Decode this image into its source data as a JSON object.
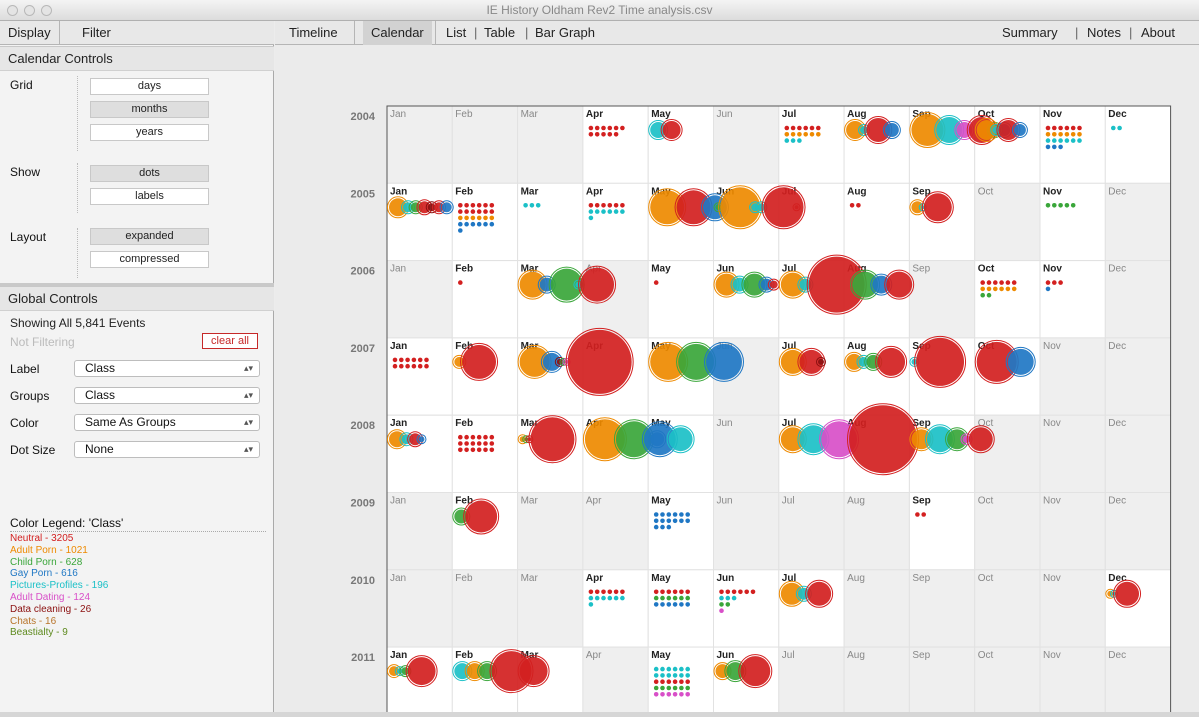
{
  "window": {
    "title": "IE History Oldham Rev2 Time analysis.csv"
  },
  "sidebar": {
    "tabs": [
      "Display",
      "Filter"
    ],
    "calendar_controls": {
      "title": "Calendar Controls",
      "grid_label": "Grid",
      "grid_options": [
        "days",
        "months",
        "years"
      ],
      "grid_selected": "months",
      "show_label": "Show",
      "show_options": [
        "dots",
        "labels"
      ],
      "show_selected": "dots",
      "layout_label": "Layout",
      "layout_options": [
        "expanded",
        "compressed"
      ],
      "layout_selected": "expanded"
    },
    "global_controls": {
      "title": "Global Controls",
      "showing": "Showing All 5,841 Events",
      "filter_status": "Not Filtering",
      "clear_all": "clear all",
      "label_label": "Label",
      "label_value": "Class",
      "groups_label": "Groups",
      "groups_value": "Class",
      "color_label": "Color",
      "color_value": "Same As Groups",
      "dotsize_label": "Dot Size",
      "dotsize_value": "None"
    },
    "legend": {
      "title": "Color Legend: 'Class'",
      "items": [
        {
          "text": "Neutral - 3205",
          "color": "#d32020"
        },
        {
          "text": "Adult Porn - 1021",
          "color": "#ee8a00"
        },
        {
          "text": "Child Porn - 628",
          "color": "#3aa63a"
        },
        {
          "text": "Gay Porn - 616",
          "color": "#1f77c4"
        },
        {
          "text": "Pictures-Profiles - 196",
          "color": "#1bc0c7"
        },
        {
          "text": "Adult Dating - 124",
          "color": "#d84fc8"
        },
        {
          "text": "Data cleaning - 26",
          "color": "#8b1010"
        },
        {
          "text": "Chats - 16",
          "color": "#b8742a"
        },
        {
          "text": "Beastialty - 9",
          "color": "#5e8a1e"
        }
      ]
    }
  },
  "main": {
    "tabs_left": [
      "Timeline",
      "Calendar",
      "List",
      "Table",
      "Bar Graph"
    ],
    "active_tab": "Calendar",
    "tabs_right": [
      "Summary",
      "Notes",
      "About"
    ]
  },
  "calendar": {
    "years": [
      "2004",
      "2005",
      "2006",
      "2007",
      "2008",
      "2009",
      "2010",
      "2011"
    ],
    "months": [
      "Jan",
      "Feb",
      "Mar",
      "Apr",
      "May",
      "Jun",
      "Jul",
      "Aug",
      "Sep",
      "Oct",
      "Nov",
      "Dec"
    ],
    "active_months": [
      [
        0,
        0,
        0,
        1,
        1,
        0,
        1,
        1,
        1,
        1,
        1,
        1
      ],
      [
        1,
        1,
        1,
        1,
        1,
        1,
        1,
        1,
        1,
        0,
        1,
        0
      ],
      [
        0,
        1,
        1,
        0,
        1,
        1,
        1,
        1,
        0,
        1,
        1,
        0
      ],
      [
        1,
        1,
        1,
        1,
        1,
        0,
        1,
        1,
        1,
        1,
        0,
        0
      ],
      [
        1,
        1,
        1,
        1,
        1,
        0,
        1,
        1,
        1,
        0,
        0,
        0
      ],
      [
        0,
        1,
        0,
        0,
        1,
        0,
        0,
        0,
        1,
        0,
        0,
        0
      ],
      [
        0,
        0,
        0,
        1,
        1,
        1,
        1,
        0,
        0,
        0,
        0,
        1
      ],
      [
        1,
        1,
        1,
        0,
        1,
        1,
        0,
        0,
        0,
        0,
        0,
        0
      ]
    ],
    "cells": [
      {
        "r": 0,
        "m": 3,
        "dots": [
          [
            "r",
            11
          ]
        ]
      },
      {
        "r": 0,
        "m": 4,
        "bubbles": [
          [
            "c",
            8
          ],
          [
            "r",
            9
          ]
        ]
      },
      {
        "r": 0,
        "m": 6,
        "dots": [
          [
            "r",
            6
          ],
          [
            "o",
            6
          ],
          [
            "c",
            3
          ]
        ]
      },
      {
        "r": 0,
        "m": 7,
        "bubbles": [
          [
            "o",
            9
          ],
          [
            "c",
            4
          ],
          [
            "r",
            12
          ],
          [
            "b",
            7
          ]
        ]
      },
      {
        "r": 0,
        "m": 8,
        "bubbles": [
          [
            "o",
            16
          ],
          [
            "c",
            13
          ],
          [
            "p",
            8
          ],
          [
            "r",
            13
          ],
          [
            "g",
            6
          ],
          [
            "b",
            6
          ]
        ]
      },
      {
        "r": 0,
        "m": 9,
        "bubbles": [
          [
            "o",
            10
          ],
          [
            "c",
            4
          ],
          [
            "r",
            10
          ],
          [
            "b",
            6
          ]
        ]
      },
      {
        "r": 0,
        "m": 10,
        "dots": [
          [
            "r",
            6
          ],
          [
            "o",
            6
          ],
          [
            "c",
            6
          ],
          [
            "b",
            3
          ]
        ]
      },
      {
        "r": 0,
        "m": 11,
        "dots": [
          [
            "c",
            2
          ]
        ]
      },
      {
        "r": 1,
        "m": 0,
        "bubbles": [
          [
            "o",
            9
          ],
          [
            "c",
            5
          ],
          [
            "g",
            5
          ],
          [
            "r",
            6
          ],
          [
            "k",
            4
          ],
          [
            "r",
            5
          ],
          [
            "b",
            5
          ]
        ]
      },
      {
        "r": 1,
        "m": 1,
        "dots": [
          [
            "r",
            12
          ],
          [
            "o",
            6
          ],
          [
            "b",
            6
          ],
          [
            "b",
            1
          ]
        ]
      },
      {
        "r": 1,
        "m": 2,
        "dots": [
          [
            "c",
            3
          ]
        ]
      },
      {
        "r": 1,
        "m": 3,
        "dots": [
          [
            "r",
            6
          ],
          [
            "c",
            6
          ],
          [
            "c",
            1
          ]
        ]
      },
      {
        "r": 1,
        "m": 4,
        "bubbles": [
          [
            "o",
            17
          ],
          [
            "r",
            17
          ],
          [
            "b",
            12
          ]
        ]
      },
      {
        "r": 1,
        "m": 5,
        "bubbles": [
          [
            "g",
            3
          ],
          [
            "o",
            20
          ],
          [
            "c",
            4
          ],
          [
            "c",
            4
          ],
          [
            "r",
            20
          ],
          [
            "r",
            2
          ]
        ]
      },
      {
        "r": 1,
        "m": 7,
        "dots": [
          [
            "r",
            2
          ]
        ]
      },
      {
        "r": 1,
        "m": 8,
        "bubbles": [
          [
            "o",
            6
          ],
          [
            "c",
            2
          ],
          [
            "r",
            14
          ]
        ]
      },
      {
        "r": 1,
        "m": 10,
        "dots": [
          [
            "g",
            5
          ]
        ]
      },
      {
        "r": 2,
        "m": 1,
        "dots": [
          [
            "r",
            1
          ]
        ]
      },
      {
        "r": 2,
        "m": 2,
        "bubbles": [
          [
            "o",
            13
          ],
          [
            "b",
            7
          ],
          [
            "g",
            16
          ],
          [
            "c",
            3
          ],
          [
            "r",
            17
          ]
        ]
      },
      {
        "r": 2,
        "m": 4,
        "dots": [
          [
            "r",
            1
          ]
        ]
      },
      {
        "r": 2,
        "m": 5,
        "bubbles": [
          [
            "o",
            11
          ],
          [
            "c",
            7
          ],
          [
            "g",
            11
          ],
          [
            "b",
            6
          ],
          [
            "r",
            4
          ]
        ]
      },
      {
        "r": 2,
        "m": 6,
        "bubbles": [
          [
            "o",
            12
          ],
          [
            "c",
            6
          ],
          [
            "r",
            28
          ],
          [
            "g",
            13
          ],
          [
            "b",
            9
          ],
          [
            "r",
            13
          ]
        ]
      },
      {
        "r": 2,
        "m": 9,
        "dots": [
          [
            "r",
            6
          ],
          [
            "o",
            6
          ],
          [
            "g",
            2
          ]
        ]
      },
      {
        "r": 2,
        "m": 10,
        "dots": [
          [
            "r",
            3
          ],
          [
            "b",
            1
          ]
        ]
      },
      {
        "r": 3,
        "m": 0,
        "dots": [
          [
            "r",
            12
          ]
        ]
      },
      {
        "r": 3,
        "m": 1,
        "bubbles": [
          [
            "o",
            5
          ],
          [
            "r",
            17
          ]
        ]
      },
      {
        "r": 3,
        "m": 2,
        "bubbles": [
          [
            "o",
            15
          ],
          [
            "b",
            9
          ],
          [
            "k",
            3
          ],
          [
            "g",
            2
          ],
          [
            "p",
            2
          ],
          [
            "r",
            32
          ]
        ]
      },
      {
        "r": 3,
        "m": 4,
        "bubbles": [
          [
            "o",
            18
          ],
          [
            "g",
            18
          ],
          [
            "b",
            18
          ]
        ]
      },
      {
        "r": 3,
        "m": 6,
        "bubbles": [
          [
            "o",
            12
          ],
          [
            "r",
            12
          ],
          [
            "k",
            3
          ]
        ]
      },
      {
        "r": 3,
        "m": 7,
        "bubbles": [
          [
            "o",
            8
          ],
          [
            "c",
            5
          ],
          [
            "g",
            7
          ],
          [
            "r",
            14
          ]
        ]
      },
      {
        "r": 3,
        "m": 8,
        "bubbles": [
          [
            "c",
            3
          ],
          [
            "r",
            24
          ]
        ]
      },
      {
        "r": 3,
        "m": 9,
        "bubbles": [
          [
            "r",
            20
          ],
          [
            "b",
            13
          ]
        ]
      },
      {
        "r": 4,
        "m": 0,
        "bubbles": [
          [
            "o",
            8
          ],
          [
            "c",
            5
          ],
          [
            "r",
            6
          ],
          [
            "b",
            3
          ]
        ]
      },
      {
        "r": 4,
        "m": 1,
        "dots": [
          [
            "r",
            18
          ]
        ]
      },
      {
        "r": 4,
        "m": 2,
        "bubbles": [
          [
            "o",
            3
          ],
          [
            "g",
            2
          ],
          [
            "r",
            2
          ],
          [
            "r",
            22
          ]
        ]
      },
      {
        "r": 4,
        "m": 3,
        "bubbles": [
          [
            "o",
            20
          ],
          [
            "g",
            18
          ],
          [
            "b",
            16
          ],
          [
            "c",
            12
          ]
        ]
      },
      {
        "r": 4,
        "m": 4,
        "bubbles": [
          [
            "b",
            7
          ]
        ]
      },
      {
        "r": 4,
        "m": 6,
        "bubbles": [
          [
            "o",
            12
          ],
          [
            "c",
            14
          ],
          [
            "p",
            18
          ],
          [
            "r",
            34
          ]
        ]
      },
      {
        "r": 4,
        "m": 8,
        "bubbles": [
          [
            "o",
            10
          ],
          [
            "c",
            13
          ],
          [
            "g",
            10
          ],
          [
            "p",
            4
          ],
          [
            "r",
            12
          ]
        ]
      },
      {
        "r": 5,
        "m": 1,
        "bubbles": [
          [
            "g",
            7
          ],
          [
            "r",
            16
          ]
        ]
      },
      {
        "r": 5,
        "m": 4,
        "dots": [
          [
            "b",
            15
          ]
        ]
      },
      {
        "r": 5,
        "m": 8,
        "dots": [
          [
            "r",
            2
          ]
        ]
      },
      {
        "r": 6,
        "m": 3,
        "dots": [
          [
            "r",
            6
          ],
          [
            "c",
            6
          ],
          [
            "c",
            1
          ]
        ]
      },
      {
        "r": 6,
        "m": 4,
        "dots": [
          [
            "r",
            6
          ],
          [
            "g",
            6
          ],
          [
            "b",
            6
          ]
        ]
      },
      {
        "r": 6,
        "m": 5,
        "dots": [
          [
            "r",
            6
          ],
          [
            "c",
            3
          ],
          [
            "g",
            2
          ],
          [
            "p",
            1
          ]
        ]
      },
      {
        "r": 6,
        "m": 6,
        "bubbles": [
          [
            "o",
            11
          ],
          [
            "c",
            6
          ],
          [
            "r",
            12
          ]
        ]
      },
      {
        "r": 6,
        "m": 11,
        "bubbles": [
          [
            "o",
            3
          ],
          [
            "c",
            2
          ],
          [
            "r",
            12
          ]
        ]
      },
      {
        "r": 7,
        "m": 0,
        "bubbles": [
          [
            "o",
            5
          ],
          [
            "c",
            3
          ],
          [
            "g",
            4
          ],
          [
            "r",
            14
          ]
        ]
      },
      {
        "r": 7,
        "m": 1,
        "bubbles": [
          [
            "c",
            8
          ],
          [
            "o",
            8
          ],
          [
            "g",
            8
          ],
          [
            "r",
            20
          ]
        ]
      },
      {
        "r": 7,
        "m": 2,
        "bubbles": [
          [
            "r",
            14
          ]
        ]
      },
      {
        "r": 7,
        "m": 4,
        "dots": [
          [
            "c",
            12
          ],
          [
            "r",
            6
          ],
          [
            "g",
            6
          ],
          [
            "p",
            6
          ]
        ]
      },
      {
        "r": 7,
        "m": 5,
        "bubbles": [
          [
            "o",
            7
          ],
          [
            "g",
            9
          ],
          [
            "r",
            15
          ]
        ]
      }
    ],
    "colors": {
      "r": "#d32020",
      "o": "#ee8a00",
      "g": "#3aa63a",
      "b": "#1f77c4",
      "c": "#1bc0c7",
      "p": "#d84fc8",
      "k": "#8b1010"
    }
  }
}
